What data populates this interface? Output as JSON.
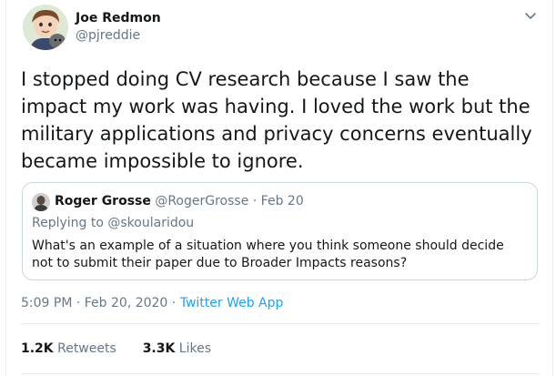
{
  "author": {
    "name": "Joe Redmon",
    "handle": "@pjreddie"
  },
  "tweet": {
    "text": "I stopped doing CV research because I saw the impact my work was having. I loved the work but the military applications and privacy concerns eventually became impossible to ignore."
  },
  "quoted_tweet": {
    "name": "Roger Grosse",
    "handle": "@RogerGrosse",
    "separator": "·",
    "date": "Feb 20",
    "replying_prefix": "Replying to",
    "replying_to": "@skoularidou",
    "text": "What's an example of a situation where you think someone should decide not to submit their paper due to Broader Impacts reasons?"
  },
  "meta": {
    "time_date": "5:09 PM · Feb 20, 2020",
    "separator": "·",
    "source": "Twitter Web App"
  },
  "stats": {
    "retweets_count": "1.2K",
    "retweets_label": "Retweets",
    "likes_count": "3.3K",
    "likes_label": "Likes"
  },
  "colors": {
    "text": "#14171a",
    "secondary": "#657786",
    "link": "#1da1f2",
    "border": "#ccd6dd"
  },
  "icons": {
    "menu": "chevron-down-icon"
  }
}
